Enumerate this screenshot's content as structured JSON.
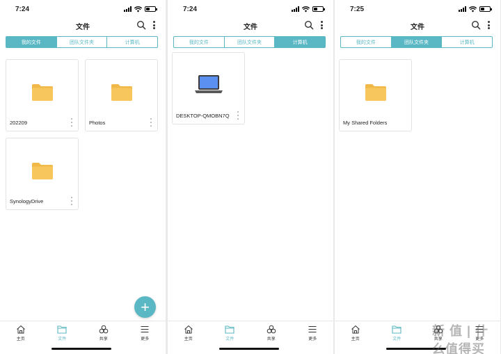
{
  "screens": [
    {
      "time": "7:24",
      "title": "文件",
      "tabs": [
        "我的文件",
        "团队文件夹",
        "计算机"
      ],
      "active_tab": 0,
      "items": [
        {
          "name": "202209",
          "icon": "folder-icon"
        },
        {
          "name": "Photos",
          "icon": "folder-icon"
        },
        {
          "name": "SynologyDrive",
          "icon": "folder-icon"
        }
      ],
      "fab": "+",
      "nav": [
        "主页",
        "文件",
        "共享",
        "更多"
      ],
      "nav_active": 1
    },
    {
      "time": "7:24",
      "title": "文件",
      "tabs": [
        "我的文件",
        "团队文件夹",
        "计算机"
      ],
      "active_tab": 2,
      "items": [
        {
          "name": "DESKTOP-QMOBN7Q",
          "icon": "laptop-icon"
        }
      ],
      "nav": [
        "主页",
        "文件",
        "共享",
        "更多"
      ],
      "nav_active": 1
    },
    {
      "time": "7:25",
      "title": "文件",
      "tabs": [
        "我的文件",
        "团队文件夹",
        "计算机"
      ],
      "active_tab": 1,
      "items": [
        {
          "name": "My Shared Folders",
          "icon": "folder-icon"
        }
      ],
      "nav": [
        "主页",
        "文件",
        "共享",
        "更多"
      ],
      "nav_active": 1
    }
  ],
  "watermark": "新 值 | 什么值得买",
  "colors": {
    "accent": "#5ab8c4",
    "folder": "#f7c65c",
    "folder_tab": "#f1b84a",
    "laptop_screen": "#5b8ff0"
  }
}
